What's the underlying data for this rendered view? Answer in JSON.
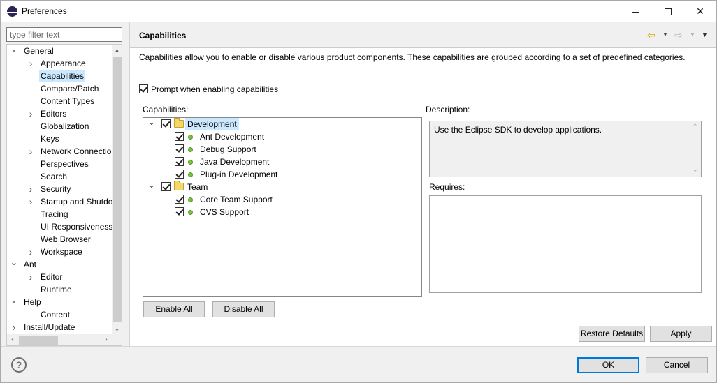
{
  "window": {
    "title": "Preferences",
    "minimize_icon": "minimize-icon",
    "maximize_icon": "maximize-icon",
    "close_glyph": "✕"
  },
  "sidebar": {
    "filter_placeholder": "type filter text",
    "items": [
      {
        "label": "General",
        "level": 0,
        "toggle": "v"
      },
      {
        "label": "Appearance",
        "level": 1,
        "toggle": ">"
      },
      {
        "label": "Capabilities",
        "level": 1,
        "toggle": "",
        "selected": true
      },
      {
        "label": "Compare/Patch",
        "level": 1,
        "toggle": ""
      },
      {
        "label": "Content Types",
        "level": 1,
        "toggle": ""
      },
      {
        "label": "Editors",
        "level": 1,
        "toggle": ">"
      },
      {
        "label": "Globalization",
        "level": 1,
        "toggle": ""
      },
      {
        "label": "Keys",
        "level": 1,
        "toggle": ""
      },
      {
        "label": "Network Connection",
        "level": 1,
        "toggle": ">"
      },
      {
        "label": "Perspectives",
        "level": 1,
        "toggle": ""
      },
      {
        "label": "Search",
        "level": 1,
        "toggle": ""
      },
      {
        "label": "Security",
        "level": 1,
        "toggle": ">"
      },
      {
        "label": "Startup and Shutdown",
        "level": 1,
        "toggle": ">"
      },
      {
        "label": "Tracing",
        "level": 1,
        "toggle": ""
      },
      {
        "label": "UI Responsiveness M",
        "level": 1,
        "toggle": ""
      },
      {
        "label": "Web Browser",
        "level": 1,
        "toggle": ""
      },
      {
        "label": "Workspace",
        "level": 1,
        "toggle": ">"
      },
      {
        "label": "Ant",
        "level": 0,
        "toggle": "v"
      },
      {
        "label": "Editor",
        "level": 1,
        "toggle": ">"
      },
      {
        "label": "Runtime",
        "level": 1,
        "toggle": ""
      },
      {
        "label": "Help",
        "level": 0,
        "toggle": "v"
      },
      {
        "label": "Content",
        "level": 1,
        "toggle": ""
      },
      {
        "label": "Install/Update",
        "level": 0,
        "toggle": ">"
      }
    ]
  },
  "page": {
    "title": "Capabilities",
    "back_icon": "back-arrow-icon",
    "forward_icon": "forward-arrow-icon",
    "menu_icon": "view-menu-icon",
    "intro": "Capabilities allow you to enable or disable various product components.  These capabilities are grouped according to a set of predefined categories.",
    "prompt_label": "Prompt when enabling capabilities",
    "prompt_checked": true,
    "capabilities_label": "Capabilities:",
    "tree": [
      {
        "label": "Development",
        "type": "category",
        "checked": true,
        "selected": true,
        "children": [
          {
            "label": "Ant Development",
            "checked": true
          },
          {
            "label": "Debug Support",
            "checked": true
          },
          {
            "label": "Java Development",
            "checked": true
          },
          {
            "label": "Plug-in Development",
            "checked": true
          }
        ]
      },
      {
        "label": "Team",
        "type": "category",
        "checked": true,
        "selected": false,
        "children": [
          {
            "label": "Core Team Support",
            "checked": true
          },
          {
            "label": "CVS Support",
            "checked": true
          }
        ]
      }
    ],
    "description_label": "Description:",
    "description_text": "Use the Eclipse SDK to develop applications.",
    "requires_label": "Requires:",
    "enable_all": "Enable All",
    "disable_all": "Disable All",
    "restore_defaults": "Restore Defaults",
    "apply": "Apply"
  },
  "footer": {
    "help_glyph": "?",
    "ok": "OK",
    "cancel": "Cancel"
  }
}
